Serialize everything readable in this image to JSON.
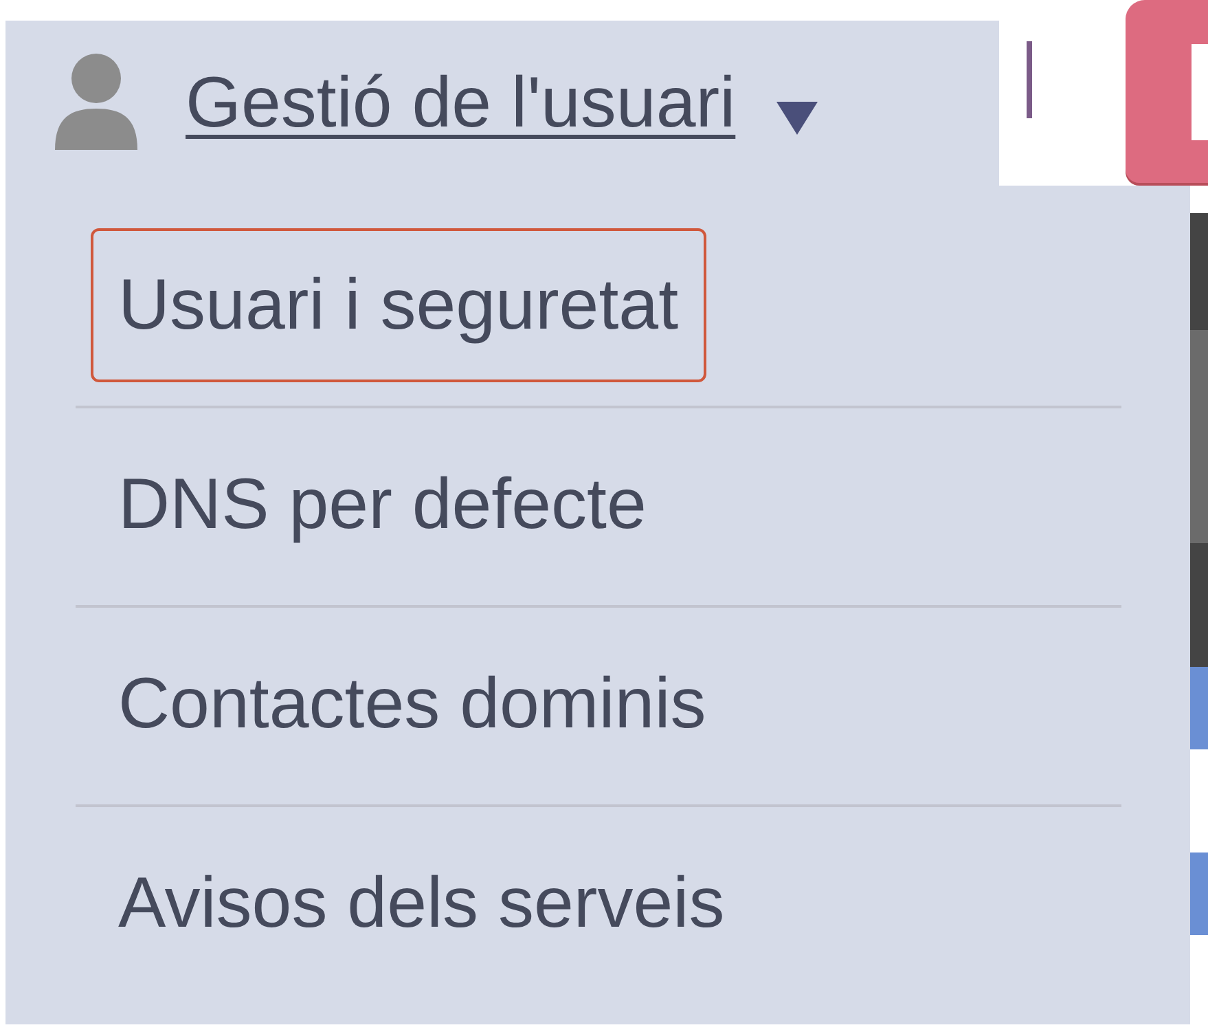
{
  "menu": {
    "title": "Gestió de l'usuari",
    "items": [
      {
        "label": "Usuari i seguretat",
        "selected": true
      },
      {
        "label": "DNS per defecte",
        "selected": false
      },
      {
        "label": "Contactes dominis",
        "selected": false
      },
      {
        "label": "Avisos dels serveis",
        "selected": false
      }
    ]
  }
}
